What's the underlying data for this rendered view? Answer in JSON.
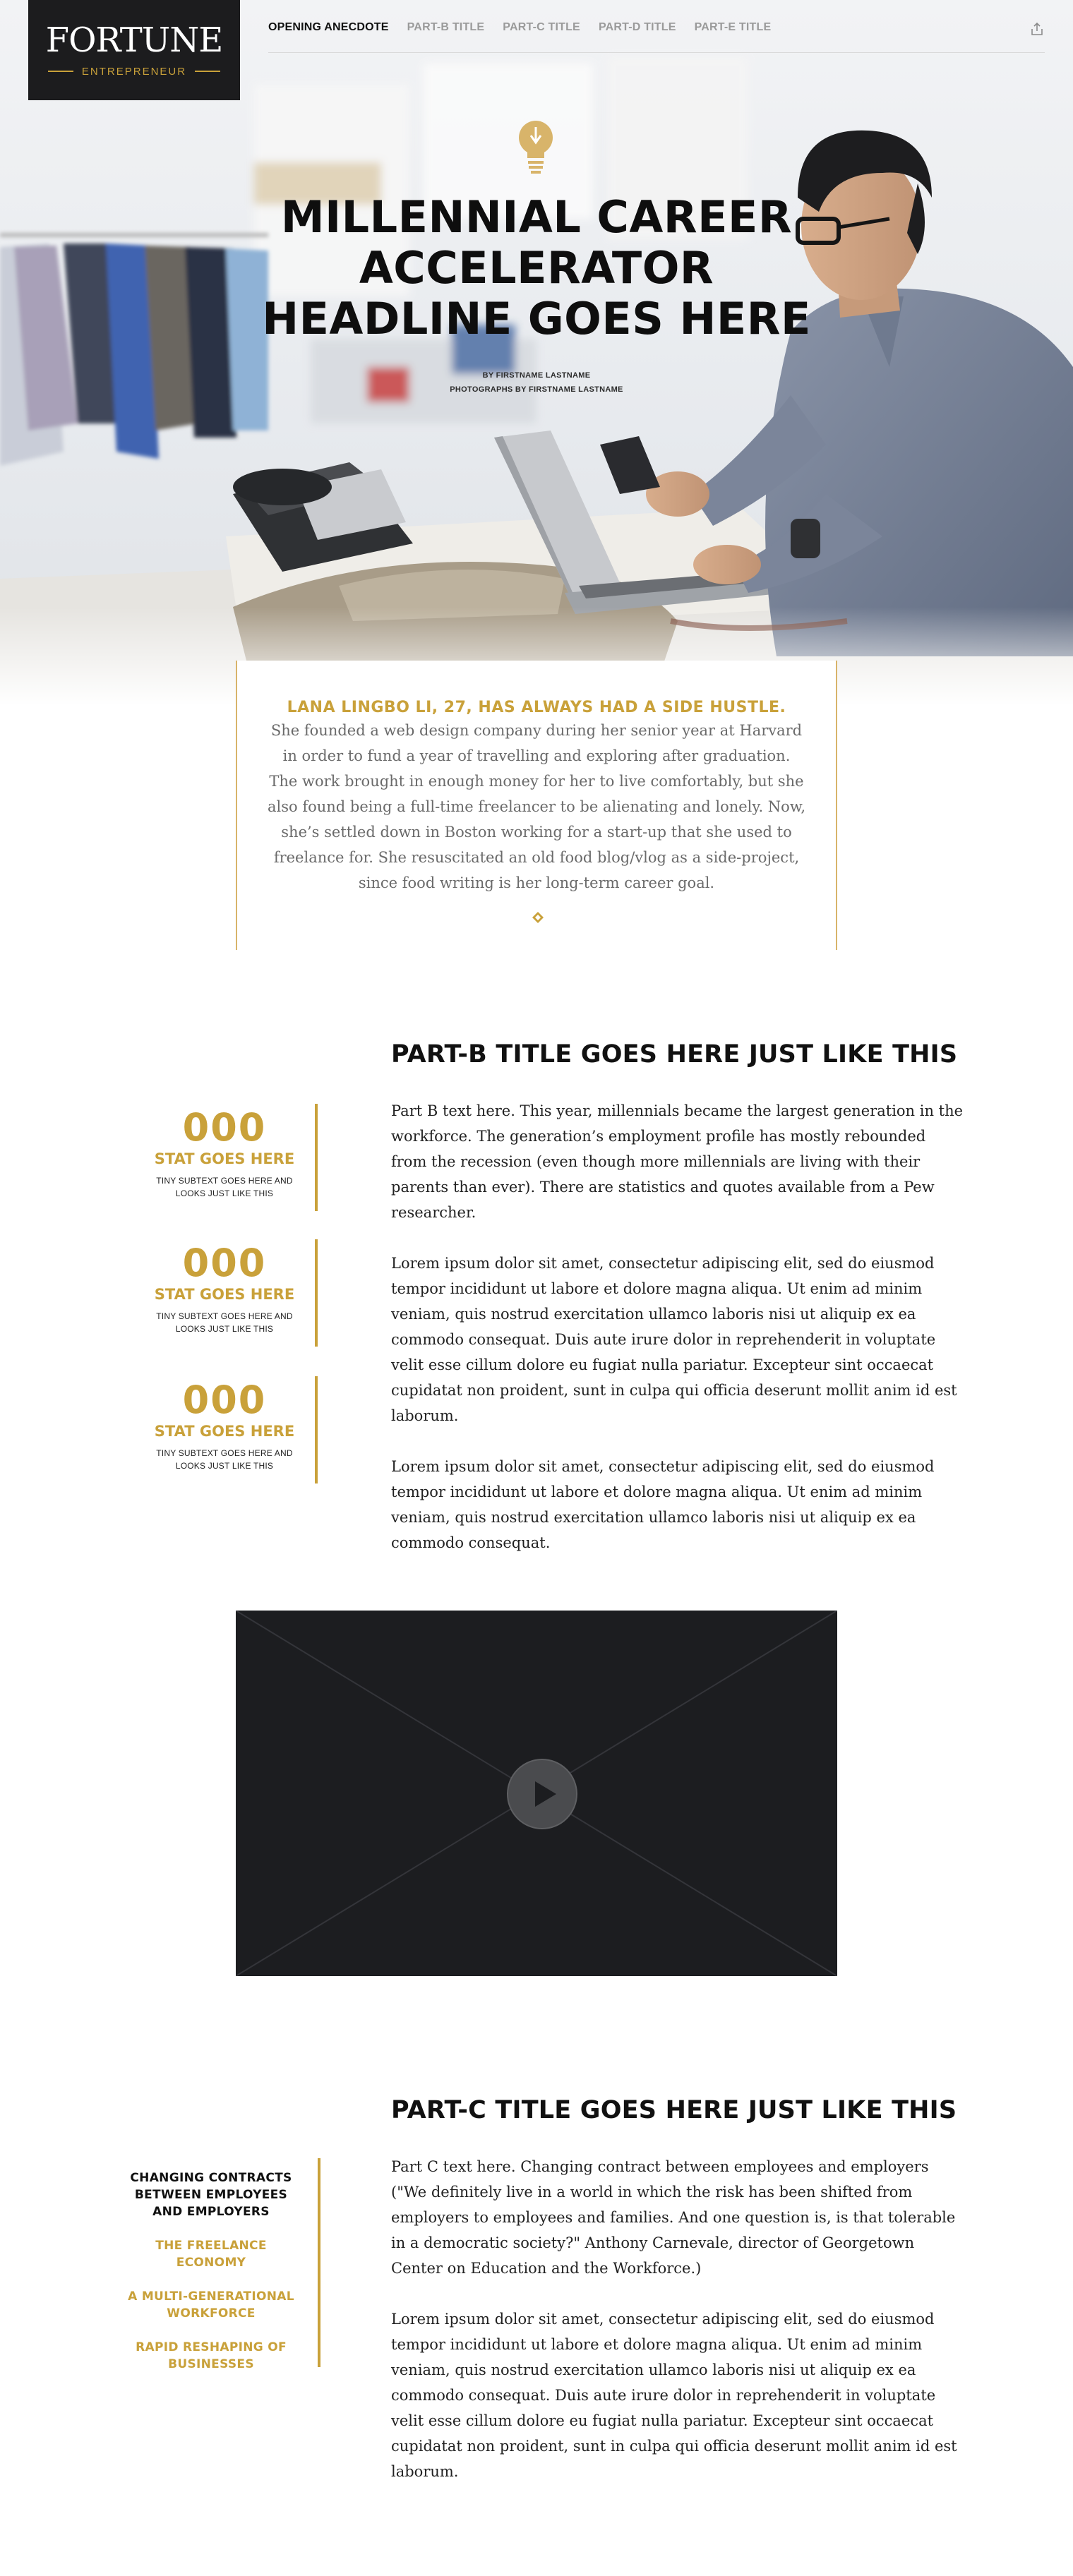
{
  "logo": {
    "wordmark": "FORTUNE",
    "sub": "ENTREPRENEUR"
  },
  "nav": {
    "items": [
      "OPENING ANECDOTE",
      "PART-B TITLE",
      "PART-C TITLE",
      "PART-D TITLE",
      "PART-E TITLE"
    ],
    "active_index": 0,
    "share_icon": "share-icon"
  },
  "hero": {
    "icon": "lightbulb-icon",
    "title": "MILLENNIAL CAREER ACCELERATOR HEADLINE GOES HERE",
    "byline": "BY FIRSTNAME LASTNAME",
    "photo_credit": "PHOTOGRAPHS BY FIRSTNAME LASTNAME"
  },
  "intro": {
    "lead": "LANA LINGBO LI, 27, HAS ALWAYS HAD A SIDE HUSTLE.",
    "text": "She founded a web design company during her senior year at Harvard in order to fund a year of travelling and exploring after graduation. The work brought in enough money for her to live comfortably, but she also found being a full-time freelancer to be alienating and lonely. Now, she’s settled down in Boston working for a start-up that she used to freelance for. She resuscitated an old food blog/vlog  as a side-project, since food writing is her long-term career goal."
  },
  "partB": {
    "title": "PART-B TITLE GOES HERE JUST LIKE THIS",
    "paragraphs": [
      "Part B text here. This year, millennials became the largest generation in the workforce. The generation’s employment profile has mostly rebounded from the recession (even though more millennials are living with their parents than ever). There are statistics and quotes available from a Pew researcher.",
      "Lorem ipsum dolor sit amet, consectetur adipiscing elit, sed do eiusmod tempor incididunt ut labore et dolore magna aliqua. Ut enim ad minim veniam, quis nostrud exercitation ullamco laboris nisi ut aliquip ex ea commodo consequat. Duis aute irure dolor in reprehenderit in voluptate velit esse cillum dolore eu fugiat nulla pariatur. Excepteur sint occaecat cupidatat non proident, sunt in culpa qui officia deserunt mollit anim id est laborum.",
      "Lorem ipsum dolor sit amet, consectetur adipiscing elit, sed do eiusmod tempor incididunt ut labore et dolore magna aliqua. Ut enim ad minim veniam, quis nostrud exercitation ullamco laboris nisi ut aliquip ex ea commodo consequat."
    ],
    "stats": [
      {
        "num": "000",
        "title": "STAT GOES HERE",
        "sub1": "TINY SUBTEXT GOES HERE AND",
        "sub2": "LOOKS JUST LIKE THIS"
      },
      {
        "num": "000",
        "title": "STAT GOES HERE",
        "sub1": "TINY SUBTEXT GOES HERE AND",
        "sub2": "LOOKS JUST LIKE THIS"
      },
      {
        "num": "000",
        "title": "STAT GOES HERE",
        "sub1": "TINY SUBTEXT GOES HERE AND",
        "sub2": "LOOKS JUST LIKE THIS"
      }
    ]
  },
  "video": {
    "icon": "play-icon"
  },
  "partC": {
    "title": "PART-C TITLE GOES HERE JUST LIKE THIS",
    "paragraphs": [
      "Part C text here. Changing contract between employees and employers (\"We definitely live in a world in which the risk has been shifted from employers to employees and families. And one question is, is that tolerable in a democratic society?\" Anthony Carnevale, director of Georgetown Center on Education and the Workforce.)",
      "Lorem ipsum dolor sit amet, consectetur adipiscing elit, sed do eiusmod tempor incididunt ut labore et dolore magna aliqua. Ut enim ad minim veniam, quis nostrud exercitation ullamco laboris nisi ut aliquip ex ea commodo consequat. Duis aute irure dolor in reprehenderit in voluptate velit esse cillum dolore eu fugiat nulla pariatur. Excepteur sint occaecat cupidatat non proident, sunt in culpa qui officia deserunt mollit anim id est laborum."
    ],
    "sidebar": {
      "heading": "CHANGING CONTRACTS BETWEEN EMPLOYEES AND EMPLOYERS",
      "topics": [
        "THE FREELANCE ECONOMY",
        "A MULTI-GENERATIONAL WORKFORCE",
        "RAPID RESHAPING OF BUSINESSES"
      ]
    }
  },
  "colors": {
    "gold": "#c9a13a",
    "dark": "#1c1c1e",
    "video_bg": "#1c1d20"
  }
}
